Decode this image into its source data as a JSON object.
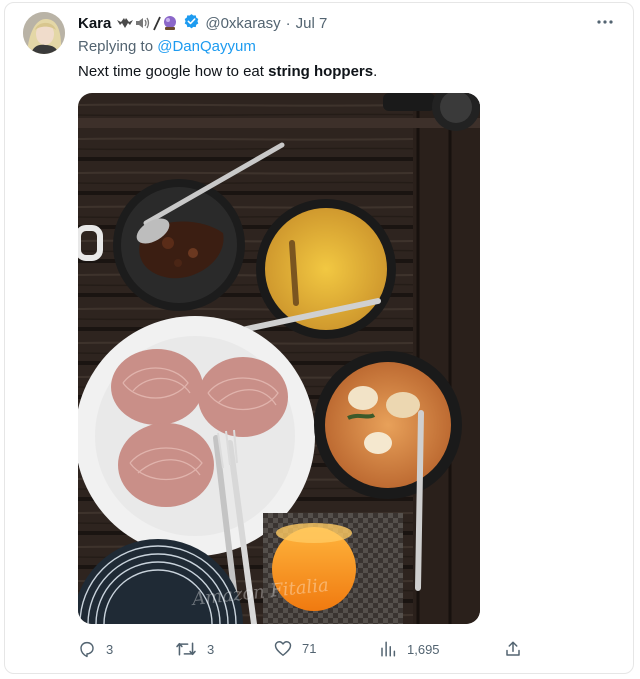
{
  "tweet": {
    "author_name": "Kara",
    "author_handle": "@0xkarasy",
    "separator": "·",
    "date": "Jul 7",
    "replying_prefix": "Replying to",
    "replying_to": "@DanQayyum",
    "text_before": "Next time google how to eat ",
    "text_bold": "string hoppers",
    "text_after": "."
  },
  "icons": {
    "more": "more-icon",
    "verified": "verified-badge-icon",
    "emoji": [
      "bat-icon",
      "speaker-icon",
      "slash-icon",
      "crystal-ball-icon"
    ]
  },
  "media": {
    "watermark_text": "Amazon Fitalia"
  },
  "actions": {
    "replies": "3",
    "reposts": "3",
    "likes": "71",
    "views": "1,695"
  },
  "colors": {
    "accent": "#1d9bf0",
    "secondary_text": "#536471",
    "text": "#0f1419"
  }
}
